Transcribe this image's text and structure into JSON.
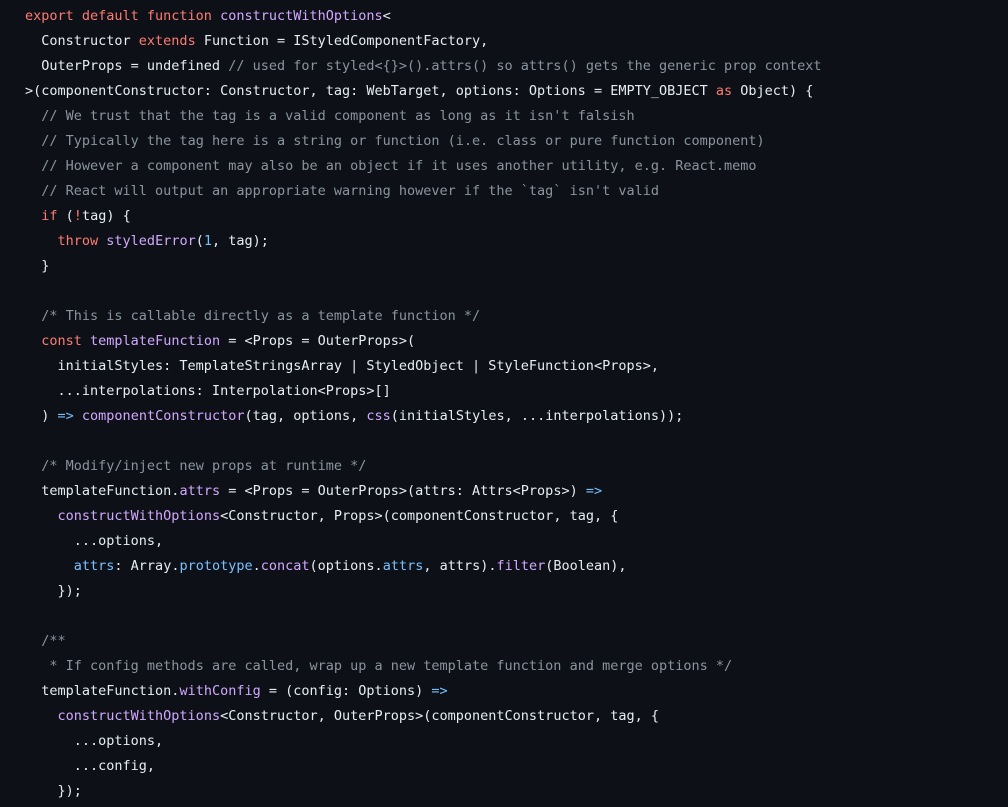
{
  "colors": {
    "background": "#0d1117",
    "plain": "#e6edf3",
    "keyword": "#ff7b72",
    "function": "#d2a8ff",
    "property": "#79c0ff",
    "comment": "#8b949e"
  },
  "code": {
    "lines": [
      [
        [
          "kw",
          "export default function "
        ],
        [
          "fn",
          "constructWithOptions"
        ],
        [
          "pl",
          "<"
        ]
      ],
      [
        [
          "pl",
          "  Constructor "
        ],
        [
          "kw",
          "extends"
        ],
        [
          "pl",
          " Function = IStyledComponentFactory,"
        ]
      ],
      [
        [
          "pl",
          "  OuterProps = undefined "
        ],
        [
          "cm",
          "// used for styled<{}>().attrs() so attrs() gets the generic prop context"
        ]
      ],
      [
        [
          "pl",
          ">(componentConstructor: Constructor, tag: WebTarget, options: Options = EMPTY_OBJECT "
        ],
        [
          "kw",
          "as"
        ],
        [
          "pl",
          " Object) {"
        ]
      ],
      [
        [
          "pl",
          "  "
        ],
        [
          "cm",
          "// We trust that the tag is a valid component as long as it isn't falsish"
        ]
      ],
      [
        [
          "pl",
          "  "
        ],
        [
          "cm",
          "// Typically the tag here is a string or function (i.e. class or pure function component)"
        ]
      ],
      [
        [
          "pl",
          "  "
        ],
        [
          "cm",
          "// However a component may also be an object if it uses another utility, e.g. React.memo"
        ]
      ],
      [
        [
          "pl",
          "  "
        ],
        [
          "cm",
          "// React will output an appropriate warning however if the `tag` isn't valid"
        ]
      ],
      [
        [
          "pl",
          "  "
        ],
        [
          "kw",
          "if"
        ],
        [
          "pl",
          " ("
        ],
        [
          "kw",
          "!"
        ],
        [
          "pl",
          "tag) {"
        ]
      ],
      [
        [
          "pl",
          "    "
        ],
        [
          "kw",
          "throw"
        ],
        [
          "pl",
          " "
        ],
        [
          "fn",
          "styledError"
        ],
        [
          "pl",
          "("
        ],
        [
          "num",
          "1"
        ],
        [
          "pl",
          ", tag);"
        ]
      ],
      [
        [
          "pl",
          "  }"
        ]
      ],
      [
        [
          "pl",
          ""
        ]
      ],
      [
        [
          "pl",
          "  "
        ],
        [
          "cm",
          "/* This is callable directly as a template function */"
        ]
      ],
      [
        [
          "pl",
          "  "
        ],
        [
          "kw",
          "const"
        ],
        [
          "pl",
          " "
        ],
        [
          "fn",
          "templateFunction"
        ],
        [
          "pl",
          " = <Props = OuterProps>("
        ]
      ],
      [
        [
          "pl",
          "    initialStyles: TemplateStringsArray | StyledObject | StyleFunction<Props>,"
        ]
      ],
      [
        [
          "pl",
          "    ...interpolations: Interpolation<Props>[]"
        ]
      ],
      [
        [
          "pl",
          "  ) "
        ],
        [
          "op",
          "=>"
        ],
        [
          "pl",
          " "
        ],
        [
          "fn",
          "componentConstructor"
        ],
        [
          "pl",
          "(tag, options, "
        ],
        [
          "fn",
          "css"
        ],
        [
          "pl",
          "(initialStyles, ...interpolations));"
        ]
      ],
      [
        [
          "pl",
          ""
        ]
      ],
      [
        [
          "pl",
          "  "
        ],
        [
          "cm",
          "/* Modify/inject new props at runtime */"
        ]
      ],
      [
        [
          "pl",
          "  templateFunction."
        ],
        [
          "fn",
          "attrs"
        ],
        [
          "pl",
          " = <Props = OuterProps>(attrs: Attrs<Props>) "
        ],
        [
          "op",
          "=>"
        ]
      ],
      [
        [
          "pl",
          "    "
        ],
        [
          "fn",
          "constructWithOptions"
        ],
        [
          "pl",
          "<Constructor, Props>(componentConstructor, tag, {"
        ]
      ],
      [
        [
          "pl",
          "      ...options,"
        ]
      ],
      [
        [
          "pl",
          "      "
        ],
        [
          "prop",
          "attrs"
        ],
        [
          "pl",
          ": Array."
        ],
        [
          "prop",
          "prototype"
        ],
        [
          "pl",
          "."
        ],
        [
          "fn",
          "concat"
        ],
        [
          "pl",
          "(options."
        ],
        [
          "prop",
          "attrs"
        ],
        [
          "pl",
          ", attrs)."
        ],
        [
          "fn",
          "filter"
        ],
        [
          "pl",
          "(Boolean),"
        ]
      ],
      [
        [
          "pl",
          "    });"
        ]
      ],
      [
        [
          "pl",
          ""
        ]
      ],
      [
        [
          "pl",
          "  "
        ],
        [
          "cm",
          "/**"
        ]
      ],
      [
        [
          "pl",
          "   "
        ],
        [
          "cm",
          "* If config methods are called, wrap up a new template function and merge options */"
        ]
      ],
      [
        [
          "pl",
          "  templateFunction."
        ],
        [
          "fn",
          "withConfig"
        ],
        [
          "pl",
          " = (config: Options) "
        ],
        [
          "op",
          "=>"
        ]
      ],
      [
        [
          "pl",
          "    "
        ],
        [
          "fn",
          "constructWithOptions"
        ],
        [
          "pl",
          "<Constructor, OuterProps>(componentConstructor, tag, {"
        ]
      ],
      [
        [
          "pl",
          "      ...options,"
        ]
      ],
      [
        [
          "pl",
          "      ...config,"
        ]
      ],
      [
        [
          "pl",
          "    });"
        ]
      ]
    ]
  }
}
